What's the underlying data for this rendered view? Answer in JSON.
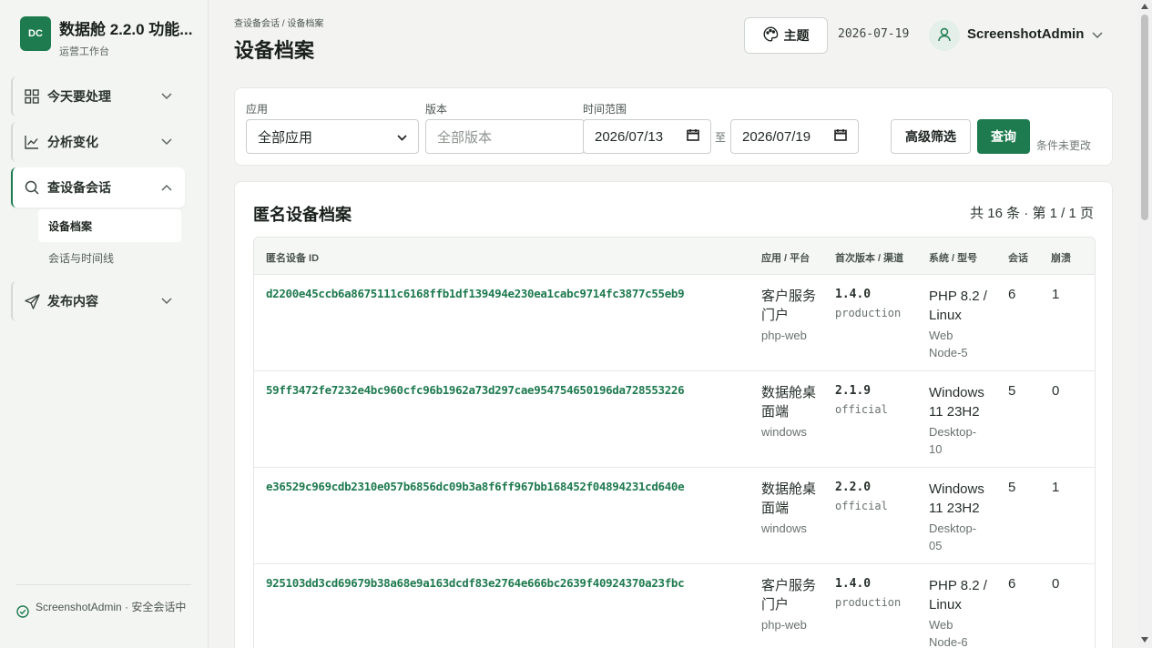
{
  "brand": {
    "logo": "DC",
    "title": "数据舱 2.2.0 功能...",
    "subtitle": "运营工作台"
  },
  "sidebar": {
    "items": [
      {
        "label": "今天要处理",
        "icon": "grid-icon",
        "expanded": false
      },
      {
        "label": "分析变化",
        "icon": "chart-icon",
        "expanded": false
      },
      {
        "label": "查设备会话",
        "icon": "search-icon",
        "expanded": true
      },
      {
        "label": "发布内容",
        "icon": "send-icon",
        "expanded": false
      }
    ],
    "sub_items": [
      {
        "label": "设备档案",
        "active": true
      },
      {
        "label": "会话与时间线",
        "active": false
      }
    ],
    "footer": "ScreenshotAdmin · 安全会话中"
  },
  "header": {
    "breadcrumb": "查设备会话 / 设备档案",
    "title": "设备档案",
    "theme_label": "主题",
    "date": "2026-07-19",
    "user": "ScreenshotAdmin"
  },
  "filters": {
    "app_label": "应用",
    "app_value": "全部应用",
    "version_label": "版本",
    "version_placeholder": "全部版本",
    "range_label": "时间范围",
    "start_date": "2026/07/13",
    "range_sep": "至",
    "end_date": "2026/07/19",
    "advanced_label": "高级筛选",
    "query_label": "查询",
    "note": "条件未更改"
  },
  "list": {
    "title": "匿名设备档案",
    "count": "共 16 条 · 第 1 / 1 页",
    "columns": [
      "匿名设备 ID",
      "应用 / 平台",
      "首次版本 / 渠道",
      "系统 / 型号",
      "会话",
      "崩溃"
    ],
    "rows": [
      {
        "id": "d2200e45ccb6a8675111c6168ffb1df139494e230ea1cabc9714fc3877c55eb9",
        "app": "客户服务门户",
        "platform": "php-web",
        "version": "1.4.0",
        "channel": "production",
        "system": "PHP 8.2 / Linux",
        "model": "Web Node-5",
        "sessions": "6",
        "crashes": "1"
      },
      {
        "id": "59ff3472fe7232e4bc960cfc96b1962a73d297cae954754650196da728553226",
        "app": "数据舱桌面端",
        "platform": "windows",
        "version": "2.1.9",
        "channel": "official",
        "system": "Windows 11 23H2",
        "model": "Desktop-10",
        "sessions": "5",
        "crashes": "0"
      },
      {
        "id": "e36529c969cdb2310e057b6856dc09b3a8f6ff967bb168452f04894231cd640e",
        "app": "数据舱桌面端",
        "platform": "windows",
        "version": "2.2.0",
        "channel": "official",
        "system": "Windows 11 23H2",
        "model": "Desktop-05",
        "sessions": "5",
        "crashes": "1"
      },
      {
        "id": "925103dd3cd69679b38a68e9a163dcdf83e2764e666bc2639f40924370a23fbc",
        "app": "客户服务门户",
        "platform": "php-web",
        "version": "1.4.0",
        "channel": "production",
        "system": "PHP 8.2 / Linux",
        "model": "Web Node-6",
        "sessions": "6",
        "crashes": "0"
      }
    ]
  },
  "colors": {
    "accent": "#1e7a4f",
    "background": "#f3f4f2"
  }
}
